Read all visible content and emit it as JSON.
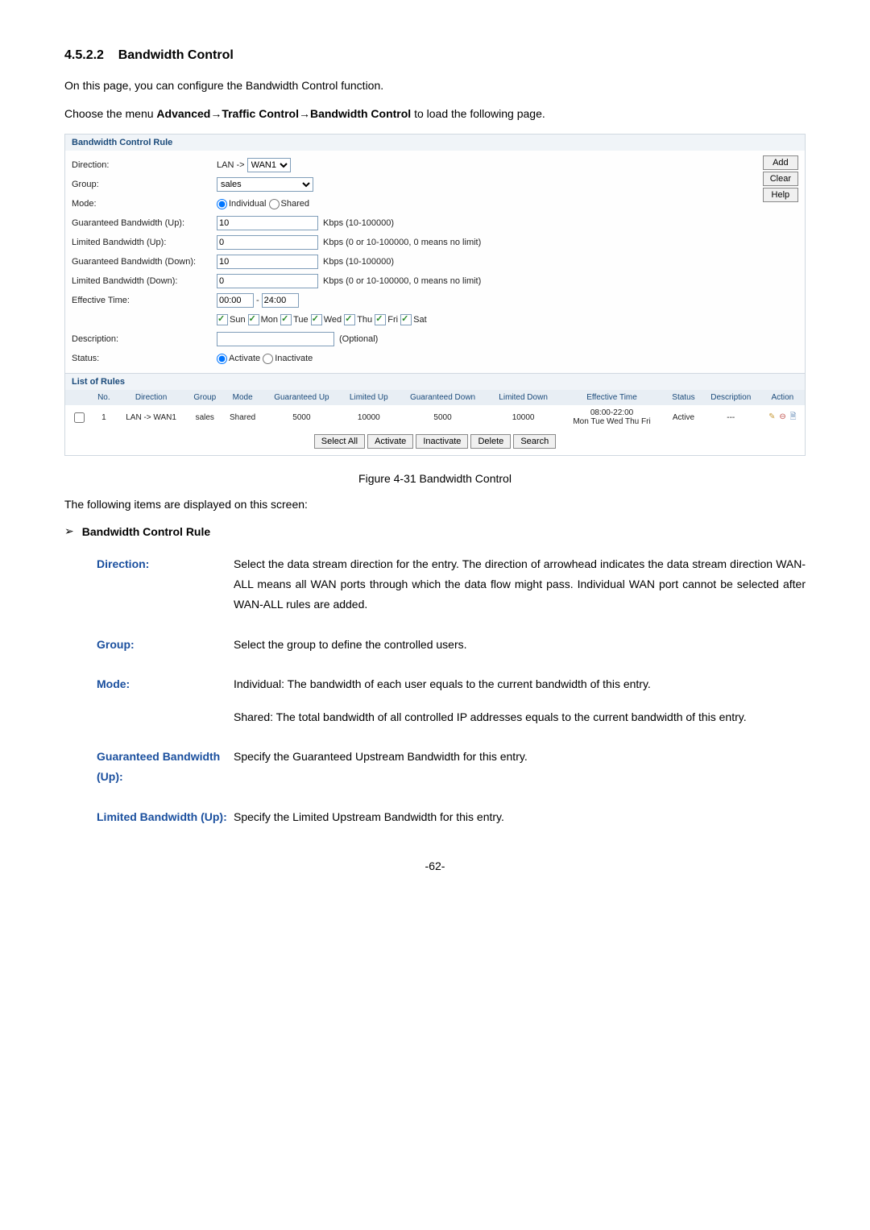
{
  "section": {
    "number": "4.5.2.2",
    "title": "Bandwidth Control"
  },
  "intro1": "On this page, you can configure the Bandwidth Control function.",
  "intro2_pre": "Choose the menu ",
  "intro2_bold": "Advanced→Traffic Control→Bandwidth Control",
  "intro2_post": " to load the following page.",
  "panel": {
    "header1": "Bandwidth Control Rule",
    "labels": {
      "direction": "Direction:",
      "group": "Group:",
      "mode": "Mode:",
      "gbw_up": "Guaranteed Bandwidth (Up):",
      "lbw_up": "Limited Bandwidth (Up):",
      "gbw_down": "Guaranteed Bandwidth (Down):",
      "lbw_down": "Limited Bandwidth (Down):",
      "eff_time": "Effective Time:",
      "description": "Description:",
      "status": "Status:"
    },
    "direction_prefix": "LAN ->",
    "direction_select": "WAN1",
    "group_select": "sales",
    "mode_individual": "Individual",
    "mode_shared": "Shared",
    "gbw_up_val": "10",
    "gbw_up_hint": "Kbps (10-100000)",
    "lbw_up_val": "0",
    "lbw_up_hint": "Kbps (0 or 10-100000, 0 means no limit)",
    "gbw_down_val": "10",
    "gbw_down_hint": "Kbps (10-100000)",
    "lbw_down_val": "0",
    "lbw_down_hint": "Kbps (0 or 10-100000, 0 means no limit)",
    "time_start": "00:00",
    "time_end": "24:00",
    "time_sep": "-",
    "days": [
      "Sun",
      "Mon",
      "Tue",
      "Wed",
      "Thu",
      "Fri",
      "Sat"
    ],
    "desc_placeholder": "(Optional)",
    "status_activate": "Activate",
    "status_inactivate": "Inactivate",
    "buttons": {
      "add": "Add",
      "clear": "Clear",
      "help": "Help"
    },
    "header2": "List of Rules",
    "cols": {
      "no": "No.",
      "direction": "Direction",
      "group": "Group",
      "mode": "Mode",
      "gup": "Guaranteed Up",
      "lup": "Limited Up",
      "gdown": "Guaranteed Down",
      "ldown": "Limited Down",
      "eff": "Effective Time",
      "status": "Status",
      "desc": "Description",
      "action": "Action"
    },
    "row": {
      "no": "1",
      "direction": "LAN -> WAN1",
      "group": "sales",
      "mode": "Shared",
      "gup": "5000",
      "lup": "10000",
      "gdown": "5000",
      "ldown": "10000",
      "eff_time": "08:00-22:00",
      "eff_days": "Mon Tue Wed Thu Fri",
      "status": "Active",
      "desc": "---"
    },
    "bottom_buttons": {
      "select_all": "Select All",
      "activate": "Activate",
      "inactivate": "Inactivate",
      "delete": "Delete",
      "search": "Search"
    }
  },
  "figure_caption": "Figure 4-31 Bandwidth Control",
  "items_intro": "The following items are displayed on this screen:",
  "bullet_title": "Bandwidth Control Rule",
  "defs": {
    "direction": {
      "label": "Direction:",
      "text": "Select the data stream direction for the entry. The direction of arrowhead indicates the data stream direction WAN-ALL means all WAN ports through which the data flow might pass. Individual WAN port cannot be selected after WAN-ALL rules are added."
    },
    "group": {
      "label": "Group:",
      "text": "Select the group to define the controlled users."
    },
    "mode": {
      "label": "Mode:",
      "text1": "Individual: The bandwidth of each user equals to the current bandwidth of this entry.",
      "text2": "Shared: The total bandwidth of all controlled IP addresses equals to the current bandwidth of this entry."
    },
    "gbw_up": {
      "label": "Guaranteed Bandwidth (Up):",
      "text": "Specify the Guaranteed Upstream Bandwidth for this entry."
    },
    "lbw_up": {
      "label": "Limited Bandwidth (Up):",
      "text": "Specify the Limited Upstream Bandwidth for this entry."
    }
  },
  "page_number": "-62-"
}
